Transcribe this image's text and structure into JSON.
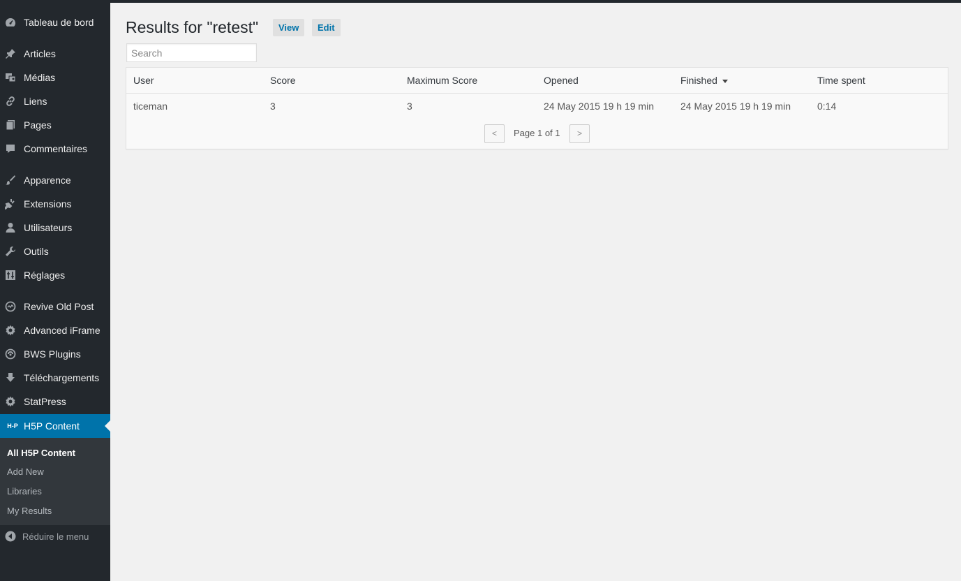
{
  "sidebar": {
    "items": [
      {
        "label": "Tableau de bord",
        "icon": "dashboard-icon"
      },
      {
        "label": "Articles",
        "icon": "pin-icon"
      },
      {
        "label": "Médias",
        "icon": "media-icon"
      },
      {
        "label": "Liens",
        "icon": "link-icon"
      },
      {
        "label": "Pages",
        "icon": "pages-icon"
      },
      {
        "label": "Commentaires",
        "icon": "comment-icon"
      },
      {
        "label": "Apparence",
        "icon": "brush-icon"
      },
      {
        "label": "Extensions",
        "icon": "plugin-icon"
      },
      {
        "label": "Utilisateurs",
        "icon": "user-icon"
      },
      {
        "label": "Outils",
        "icon": "wrench-icon"
      },
      {
        "label": "Réglages",
        "icon": "settings-icon"
      },
      {
        "label": "Revive Old Post",
        "icon": "revive-icon"
      },
      {
        "label": "Advanced iFrame",
        "icon": "gear-icon"
      },
      {
        "label": "BWS Plugins",
        "icon": "bws-icon"
      },
      {
        "label": "Téléchargements",
        "icon": "download-icon"
      },
      {
        "label": "StatPress",
        "icon": "gear-icon"
      },
      {
        "label": "H5P Content",
        "icon": "h5p-icon"
      }
    ],
    "h5p_logo_text": "H-P",
    "submenu": [
      "All H5P Content",
      "Add New",
      "Libraries",
      "My Results"
    ],
    "collapse_label": "Réduire le menu"
  },
  "header": {
    "title": "Results for \"retest\"",
    "view_label": "View",
    "edit_label": "Edit"
  },
  "search": {
    "placeholder": "Search"
  },
  "table": {
    "columns": [
      "User",
      "Score",
      "Maximum Score",
      "Opened",
      "Finished",
      "Time spent"
    ],
    "sorted_column": "Finished",
    "rows": [
      [
        "ticeman",
        "3",
        "3",
        "24 May 2015 19 h 19 min",
        "24 May 2015 19 h 19 min",
        "0:14"
      ]
    ]
  },
  "pager": {
    "prev": "<",
    "next": ">",
    "text": "Page 1 of 1"
  },
  "colors": {
    "sidebar_bg": "#23282d",
    "submenu_bg": "#32373c",
    "active_bg": "#0073aa",
    "link": "#0073aa",
    "page_bg": "#f1f1f1"
  }
}
